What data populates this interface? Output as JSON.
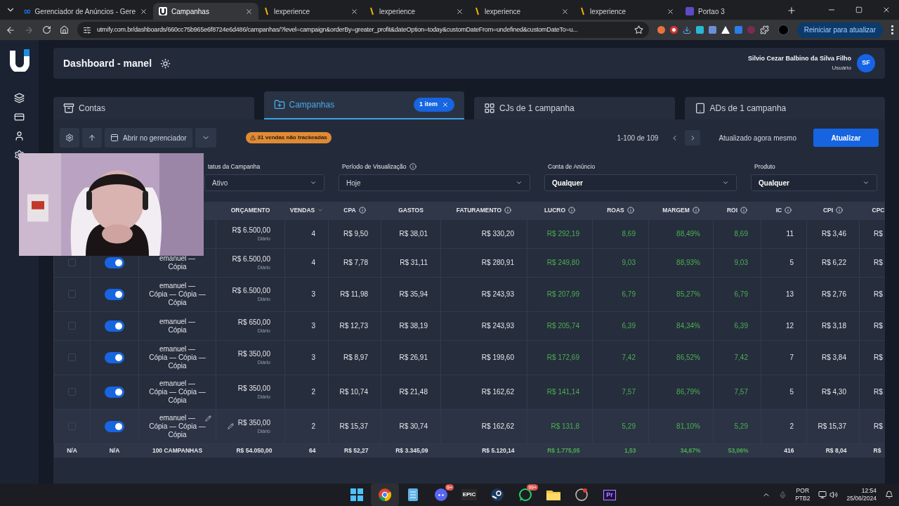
{
  "browser": {
    "tabs": [
      {
        "kind": "meta",
        "title": "Gerenciador de Anúncios - Gere",
        "selected": false
      },
      {
        "kind": "utmify",
        "title": "Campanhas",
        "selected": true
      },
      {
        "kind": "lexp",
        "title": "lexperience",
        "selected": false
      },
      {
        "kind": "lexp",
        "title": "lexperience",
        "selected": false
      },
      {
        "kind": "lexp",
        "title": "lexperience",
        "selected": false
      },
      {
        "kind": "lexp",
        "title": "lexperience",
        "selected": false
      },
      {
        "kind": "portao",
        "title": "Portao 3",
        "selected": false
      }
    ],
    "url": "utmify.com.br/dashboards/660cc75b965e6f8724e6d486/campanhas/?level=campaign&orderBy=greater_profit&dateOption=today&customDateFrom=undefined&customDateTo=u...",
    "update_button": "Reiniciar para atualizar"
  },
  "header": {
    "title": "Dashboard - manel",
    "user_name": "Silvio Cezar Balbino da Silva Filho",
    "user_role": "Usuário",
    "avatar": "SF"
  },
  "tabs": [
    {
      "kind": "contas",
      "label": "Contas",
      "selected": false
    },
    {
      "kind": "campanhas",
      "label": "Campanhas",
      "selected": true,
      "badge": "1 item"
    },
    {
      "kind": "cjs",
      "label": "CJs de 1 campanha",
      "selected": false
    },
    {
      "kind": "ads",
      "label": "ADs de 1 campanha",
      "selected": false
    }
  ],
  "toolbar": {
    "open_button": "Abrir no gerenciador",
    "warning": "31 vendas não trackeadas",
    "pagination": "1-100 de 109",
    "updated": "Atualizado agora mesmo",
    "refresh_button": "Atualizar"
  },
  "filters": [
    {
      "label": "tatus da Campanha",
      "value": "Ativo",
      "info": false,
      "highlight": false
    },
    {
      "label": "Período de Visualização",
      "value": "Hoje",
      "info": true,
      "highlight": false
    },
    {
      "label": "Conta de Anúncio",
      "value": "Qualquer",
      "info": false,
      "highlight": true
    },
    {
      "label": "Produto",
      "value": "Qualquer",
      "info": false,
      "highlight": true
    }
  ],
  "table": {
    "columns": [
      {
        "label": "ORÇAMENTO",
        "info": false,
        "sort": false,
        "positive": false
      },
      {
        "label": "VENDAS",
        "info": false,
        "sort": true,
        "positive": false
      },
      {
        "label": "CPA",
        "info": true,
        "sort": false,
        "positive": false
      },
      {
        "label": "GASTOS",
        "info": false,
        "sort": false,
        "positive": false
      },
      {
        "label": "FATURAMENTO",
        "info": true,
        "sort": false,
        "positive": false
      },
      {
        "label": "LUCRO",
        "info": true,
        "sort": false,
        "positive": true
      },
      {
        "label": "ROAS",
        "info": true,
        "sort": false,
        "positive": true
      },
      {
        "label": "MARGEM",
        "info": true,
        "sort": false,
        "positive": true
      },
      {
        "label": "ROI",
        "info": true,
        "sort": false,
        "positive": true
      },
      {
        "label": "IC",
        "info": true,
        "sort": false,
        "positive": false
      },
      {
        "label": "CPI",
        "info": true,
        "sort": false,
        "positive": false
      },
      {
        "label": "CPC",
        "positive": false
      }
    ],
    "rows": [
      {
        "hovered": false,
        "budget": "R$ 6.500,00",
        "period": "Diário",
        "values": [
          "4",
          "R$ 9,50",
          "R$ 38,01",
          "R$ 330,20",
          "R$ 292,19",
          "8,69",
          "88,49%",
          "8,69",
          "11",
          "R$ 3,46",
          "R$"
        ]
      },
      {
        "checked": false,
        "active": true,
        "name": "emanuel —\nCópia",
        "hovered": false,
        "budget": "R$ 6.500,00",
        "period": "Diário",
        "values": [
          "4",
          "R$ 7,78",
          "R$ 31,11",
          "R$ 280,91",
          "R$ 249,80",
          "9,03",
          "88,93%",
          "9,03",
          "5",
          "R$ 6,22",
          "R$"
        ]
      },
      {
        "checked": false,
        "active": true,
        "name": "emanuel —\nCópia — Cópia —\nCópia",
        "hovered": false,
        "budget": "R$ 6.500,00",
        "period": "Diário",
        "values": [
          "3",
          "R$ 11,98",
          "R$ 35,94",
          "R$ 243,93",
          "R$ 207,99",
          "6,79",
          "85,27%",
          "6,79",
          "13",
          "R$ 2,76",
          "R$"
        ]
      },
      {
        "checked": false,
        "active": true,
        "name": "emanuel —\nCópia",
        "hovered": false,
        "budget": "R$ 650,00",
        "period": "Diário",
        "values": [
          "3",
          "R$ 12,73",
          "R$ 38,19",
          "R$ 243,93",
          "R$ 205,74",
          "6,39",
          "84,34%",
          "6,39",
          "12",
          "R$ 3,18",
          "R$"
        ]
      },
      {
        "checked": false,
        "active": true,
        "name": "emanuel —\nCópia — Cópia —\nCópia",
        "hovered": false,
        "budget": "R$ 350,00",
        "period": "Diário",
        "values": [
          "3",
          "R$ 8,97",
          "R$ 26,91",
          "R$ 199,60",
          "R$ 172,69",
          "7,42",
          "86,52%",
          "7,42",
          "7",
          "R$ 3,84",
          "R$"
        ]
      },
      {
        "checked": false,
        "active": true,
        "name": "emanuel —\nCópia — Cópia —\nCópia",
        "hovered": false,
        "budget": "R$ 350,00",
        "period": "Diário",
        "values": [
          "2",
          "R$ 10,74",
          "R$ 21,48",
          "R$ 162,62",
          "R$ 141,14",
          "7,57",
          "86,79%",
          "7,57",
          "5",
          "R$ 4,30",
          "R$"
        ]
      },
      {
        "checked": false,
        "active": true,
        "name": "emanuel —\nCópia — Cópia —\nCópia",
        "hovered": true,
        "budget": "R$ 350,00",
        "period": "Diário",
        "values": [
          "2",
          "R$ 15,37",
          "R$ 30,74",
          "R$ 162,62",
          "R$ 131,8",
          "5,29",
          "81,10%",
          "5,29",
          "2",
          "R$ 15,37",
          "R$"
        ]
      }
    ],
    "footer": [
      "N/A",
      "N/A",
      "100 CAMPANHAS",
      "R$ 54.050,00",
      "64",
      "R$ 52,27",
      "R$ 3.345,09",
      "R$ 5.120,14",
      "R$ 1.775,05",
      "1,53",
      "34,67%",
      "53,06%",
      "416",
      "R$ 8,04",
      "R$"
    ]
  },
  "taskbar": {
    "apps": [
      {
        "kind": "windows",
        "selected": false
      },
      {
        "kind": "chrome",
        "selected": true
      },
      {
        "kind": "notepad",
        "selected": false
      },
      {
        "kind": "discord",
        "selected": false,
        "badge": "9+"
      },
      {
        "kind": "epic",
        "selected": false,
        "text": "EPIC"
      },
      {
        "kind": "steam",
        "selected": false
      },
      {
        "kind": "whatsapp",
        "selected": false,
        "badge": "99+"
      },
      {
        "kind": "folder",
        "selected": false
      },
      {
        "kind": "obs",
        "selected": false
      },
      {
        "kind": "premiere",
        "selected": false,
        "text": "Pr"
      }
    ],
    "lang": "POR",
    "layout": "PTB2",
    "time": "12:54",
    "date": "25/06/2024"
  }
}
